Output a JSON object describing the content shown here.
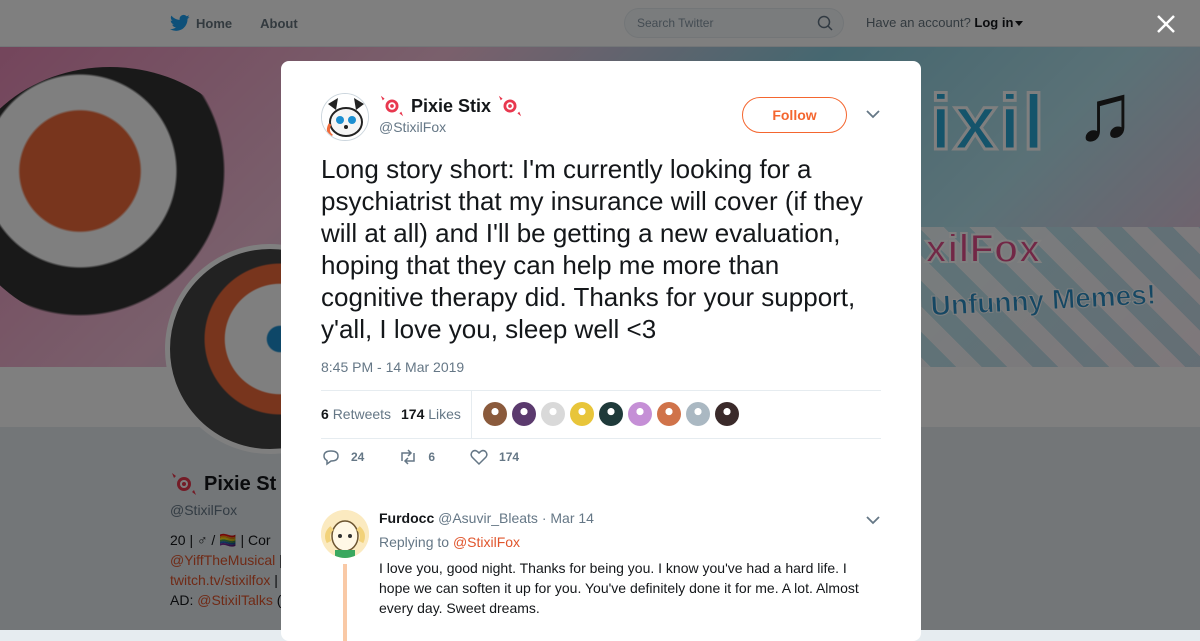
{
  "topbar": {
    "home_label": "Home",
    "about_label": "About",
    "search_placeholder": "Search Twitter",
    "account_text": "Have an account?",
    "login_label": "Log in"
  },
  "banner": {
    "title_fragment": "ixil",
    "subtitle_fragment": "xilFox",
    "tagline_fragment": "l Unfunny Memes!"
  },
  "profile": {
    "name": "Pixie St",
    "handle": "@StixilFox",
    "bio_line1": "20 | ♂ / 🏳️‍🌈 | Cor",
    "bio_link1": "@YiffTheMusical",
    "bio_link1_suffix": " |",
    "bio_link2": "twitch.tv/stixilfox",
    "bio_link2_suffix": " |",
    "bio_ad_prefix": "AD: ",
    "bio_ad_link": "@StixilTalks",
    "bio_ad_suffix": " ("
  },
  "tweet": {
    "author_name": "Pixie Stix",
    "author_handle": "@StixilFox",
    "follow_label": "Follow",
    "text": "Long story short: I'm currently looking for a psychiatrist that my insurance will cover (if they will at all) and I'll be getting a new evaluation, hoping that they can help me more than cognitive therapy did. Thanks for your support, y'all, I love you, sleep well <3",
    "timestamp": "8:45 PM - 14 Mar 2019",
    "retweets_count": "6",
    "retweets_label": "Retweets",
    "likes_count": "174",
    "likes_label": "Likes",
    "reply_count": "24",
    "retweet_count_action": "6",
    "like_count_action": "174",
    "liker_colors": [
      "#8a5a3c",
      "#5b3a6e",
      "#d9d9d9",
      "#e8c53a",
      "#1f3a3a",
      "#c58fd6",
      "#d0734a",
      "#aab8c2",
      "#3a2a2a"
    ]
  },
  "reply": {
    "author_name": "Furdocc",
    "author_handle": "@Asuvir_Bleats",
    "date": "· Mar 14",
    "replying_prefix": "Replying to",
    "replying_to": "@StixilFox",
    "text": "I love you, good night. Thanks for being you. I know you've had a hard life. I hope we can soften it up for you. You've definitely done it for me. A lot. Almost every day. Sweet dreams."
  },
  "colors": {
    "accent": "#f4662f",
    "link": "#e0552c",
    "twitter_blue": "#1da1f2"
  }
}
